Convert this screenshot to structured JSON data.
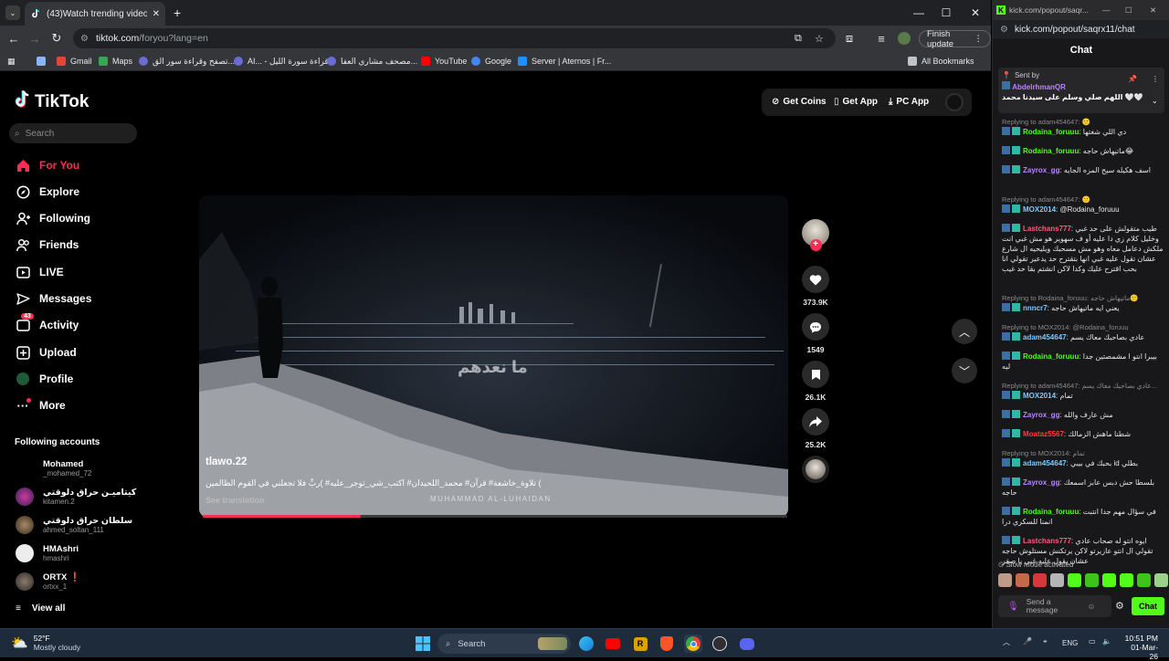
{
  "browser": {
    "tab_title": "(43)Watch trending videos for you",
    "url_host": "tiktok.com",
    "url_path": "/foryou?lang=en",
    "finish_update": "Finish update",
    "bookmarks": [
      {
        "label": "Gmail",
        "color": "#ea4335"
      },
      {
        "label": "Maps",
        "color": "#34a853"
      },
      {
        "label": "تصفح وقراءة سور الق...",
        "color": "#6b6bd6"
      },
      {
        "label": "AI... - قراءة سورة الليل",
        "color": "#6b6bd6"
      },
      {
        "label": "مصحف مشاري العفا...",
        "color": "#6b6bd6"
      },
      {
        "label": "YouTube",
        "color": "#ff0000"
      },
      {
        "label": "Google",
        "color": "#4285f4"
      },
      {
        "label": "Server | Aternos | Fr...",
        "color": "#1e90ff"
      }
    ],
    "all_bookmarks": "All Bookmarks"
  },
  "tiktok": {
    "logo": "TikTok",
    "search_placeholder": "Search",
    "nav": [
      {
        "label": "For You",
        "icon": "home-icon",
        "active": true
      },
      {
        "label": "Explore",
        "icon": "compass-icon"
      },
      {
        "label": "Following",
        "icon": "following-icon"
      },
      {
        "label": "Friends",
        "icon": "friends-icon"
      },
      {
        "label": "LIVE",
        "icon": "live-icon"
      },
      {
        "label": "Messages",
        "icon": "messages-icon"
      },
      {
        "label": "Activity",
        "icon": "activity-icon",
        "badge": "43"
      },
      {
        "label": "Upload",
        "icon": "upload-icon"
      },
      {
        "label": "Profile",
        "icon": "profile-icon"
      },
      {
        "label": "More",
        "icon": "more-icon"
      }
    ],
    "following_title": "Following accounts",
    "accounts": [
      {
        "name": "Mohamed",
        "user": "_mohamed_72"
      },
      {
        "name": "كيتاميـن حراق دلوقتي",
        "user": "kitamen.2"
      },
      {
        "name": "سلطان حراق دلوقتي",
        "user": "ahmed_soltan_111"
      },
      {
        "name": "HMAshri",
        "user": "hmashri"
      },
      {
        "name": "ORTX",
        "user": "ortxx_1"
      }
    ],
    "view_all": "View all",
    "top_buttons": {
      "coins": "Get Coins",
      "app": "Get App",
      "pc": "PC App"
    },
    "video": {
      "author": "tlawo.22",
      "caption": "تلاوة_خاشعة# قرآن# محمد_اللحيدان# اكتب_شي_توجر_عليه# )ربِّ فلا تجعلني في القوم الظالمين (",
      "see_translation": "See translation",
      "watermark": "MUHAMMAD AL-LUHAIDAN",
      "overlay_text": "ما نعدهم",
      "progress": 0.27
    },
    "actions": {
      "likes": "373.9K",
      "comments": "1549",
      "saves": "26.1K",
      "shares": "25.2K"
    }
  },
  "kick": {
    "window_url": "kick.com/popout/saqr...",
    "url": "kick.com/popout/saqrx11/chat",
    "header": "Chat",
    "pinned": {
      "label": "Sent by",
      "user": "AbdelrhmanQR",
      "text": "اللهم صلي وسلم على سيدنا محمد 🤍🤍"
    },
    "messages": [
      {
        "reply": "Replying to adam454647: 🙂",
        "user": "Rodaina_foruuu",
        "color": "#53fc18",
        "text": "دي اللي شغتها"
      },
      {
        "user": "Rodaina_foruuu",
        "color": "#53fc18",
        "text": "ماتيهاش حاجه😂"
      },
      {
        "user": "Zayrox_gg",
        "color": "#b983ff",
        "text": "اسف هكيله سيح المزه الجايه"
      },
      {
        "reply": "Replying to adam454647: 🙂",
        "user": "MOX2014",
        "color": "#7ec8ff",
        "text": "@Rodaina_foruuu"
      },
      {
        "user": "Lastchans777",
        "color": "#ff5a7a",
        "text": "طيب متقولش على حد غبي وخليل كلام زي دا عليه أو ف سهوير هو مش غبي انت ملكش دعامل معاه وهو مش مسحبك ويليحيه ال شارع عشان تقول عليه غبي انها بتقترح حد يدعير تقولي انا بحب اقترح عليك وكدا لاكن انشتم بقا حد غيب"
      },
      {
        "reply": "Replying to Rodaina_foruuu: ماتيهاش حاجه🙂",
        "user": "nnncr7",
        "color": "#7ec8ff",
        "text": "يعني ايه ماتيهاش حاجه"
      },
      {
        "reply": "Replying to MOX2014: @Rodaina_foruuu",
        "user": "adam454647",
        "color": "#7ec8ff",
        "text": "عادي بصاحبك معاك يسم"
      },
      {
        "user": "Rodaina_foruuu",
        "color": "#53fc18",
        "text": "بيبرا انتو ا مشمصتين جدا ليه"
      },
      {
        "reply": "Replying to adam454647: عادي بصاحبك معاك يسم...",
        "user": "MOX2014",
        "color": "#7ec8ff",
        "text": "تمام"
      },
      {
        "user": "Zayrox_gg",
        "color": "#b983ff",
        "text": "مش عارف والله"
      },
      {
        "user": "Moataz5567",
        "color": "#ff3b3b",
        "text": "شطنا ماهش الزمالك"
      },
      {
        "reply": "Replying to MOX2014: تمام",
        "user": "adam454647",
        "color": "#7ec8ff",
        "text": "بحبك في بيبي id بطلي"
      },
      {
        "user": "Zayrox_gg",
        "color": "#b983ff",
        "text": "بلسطا حش دبس عابز اسمعك حاجه"
      },
      {
        "user": "Rodaina_foruuu",
        "color": "#53fc18",
        "text": "في سؤال مهم جدا انتبت انمنا للسكري درا"
      },
      {
        "user": "Lastchans777",
        "color": "#ff5a7a",
        "text": "ايوه انتو له صحاب عادي تقولي ال انتو عازيرتو لاكن يرتكنش مستلوش حاجه عشان يقول عليه غبي يا صقر"
      }
    ],
    "slow_mode": "Slow mode activated",
    "send_placeholder": "Send a message",
    "chat_button": "Chat"
  },
  "taskbar": {
    "weather_temp": "52°F",
    "weather_desc": "Mostly cloudy",
    "search": "Search",
    "lang": "ENG",
    "time": "10:51 PM",
    "date": "01-Mar-26"
  }
}
